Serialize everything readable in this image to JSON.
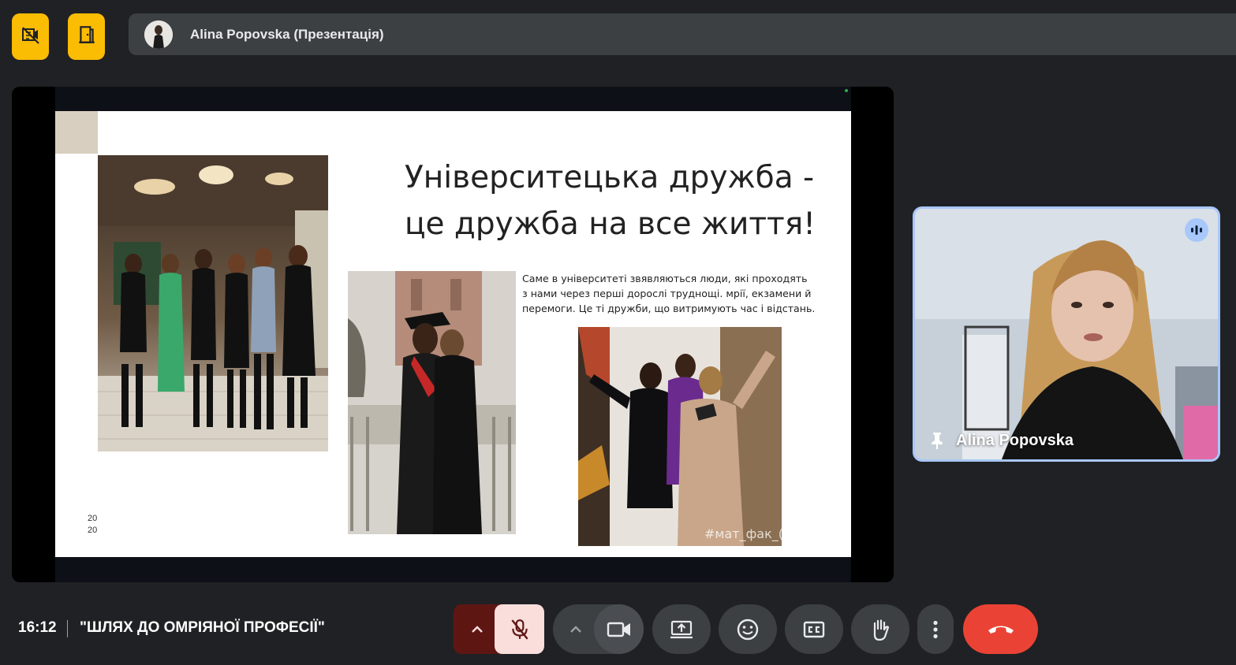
{
  "top": {
    "presenter_label": "Alina Popovska (Презентація)"
  },
  "slide": {
    "title": "Університецька дружба -\nце дружба на все життя!",
    "body": "Саме в університеті звявляються люди, які проходять з нами через перші дорослі труднощі. мрії, екзамени й перемоги. Це ті дружби, що витримують час і відстань.",
    "year_line1": "20",
    "year_line2": "20",
    "photo_watermark": "#мат_фак_("
  },
  "self_tile": {
    "name": "Alina Popovska"
  },
  "footer": {
    "clock": "16:12",
    "meeting_title": "\"ШЛЯХ ДО ОМРІЯНОЇ ПРОФЕСІЇ\""
  },
  "colors": {
    "accent_yellow": "#fbbc04",
    "end_call_red": "#ea4335",
    "mic_muted_bg": "#f9dedc",
    "mic_chevron_bg": "#5e1613",
    "tile_border": "#a8c7fa"
  },
  "icons": {
    "top_left_1": "no-video-grid-icon",
    "top_left_2": "door-exit-icon",
    "mic": "mic-off-icon",
    "camera": "videocam-icon",
    "present": "present-screen-icon",
    "emoji": "emoji-icon",
    "captions": "closed-captions-icon",
    "hand": "raise-hand-icon",
    "more": "more-vert-icon",
    "end": "call-end-icon",
    "pin": "pin-icon",
    "speaking": "audio-level-icon"
  }
}
